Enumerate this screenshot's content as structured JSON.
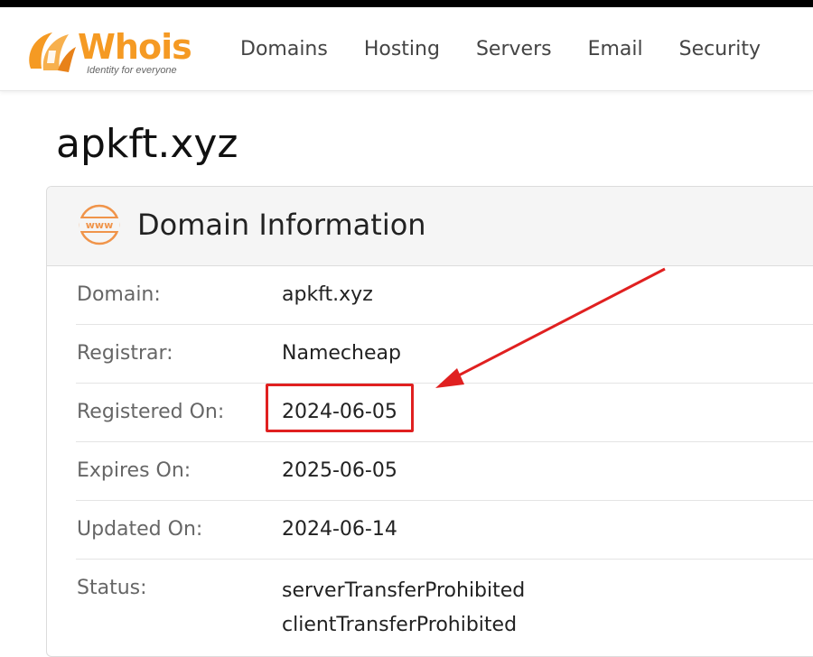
{
  "brand": {
    "name": "Whois",
    "tagline": "Identity for everyone",
    "accent_color": "#f59a23"
  },
  "nav": {
    "items": [
      {
        "label": "Domains"
      },
      {
        "label": "Hosting"
      },
      {
        "label": "Servers"
      },
      {
        "label": "Email"
      },
      {
        "label": "Security"
      }
    ]
  },
  "page": {
    "title": "apkft.xyz"
  },
  "card": {
    "icon": "www-globe-icon",
    "icon_text": "www",
    "title": "Domain Information",
    "rows": [
      {
        "label": "Domain:",
        "value": "apkft.xyz"
      },
      {
        "label": "Registrar:",
        "value": "Namecheap"
      },
      {
        "label": "Registered On:",
        "value": "2024-06-05"
      },
      {
        "label": "Expires On:",
        "value": "2025-06-05"
      },
      {
        "label": "Updated On:",
        "value": "2024-06-14"
      }
    ],
    "status": {
      "label": "Status:",
      "values": [
        "serverTransferProhibited",
        "clientTransferProhibited"
      ]
    }
  },
  "annotation": {
    "highlight_color": "#e02020",
    "highlighted_field": "Registered On"
  }
}
